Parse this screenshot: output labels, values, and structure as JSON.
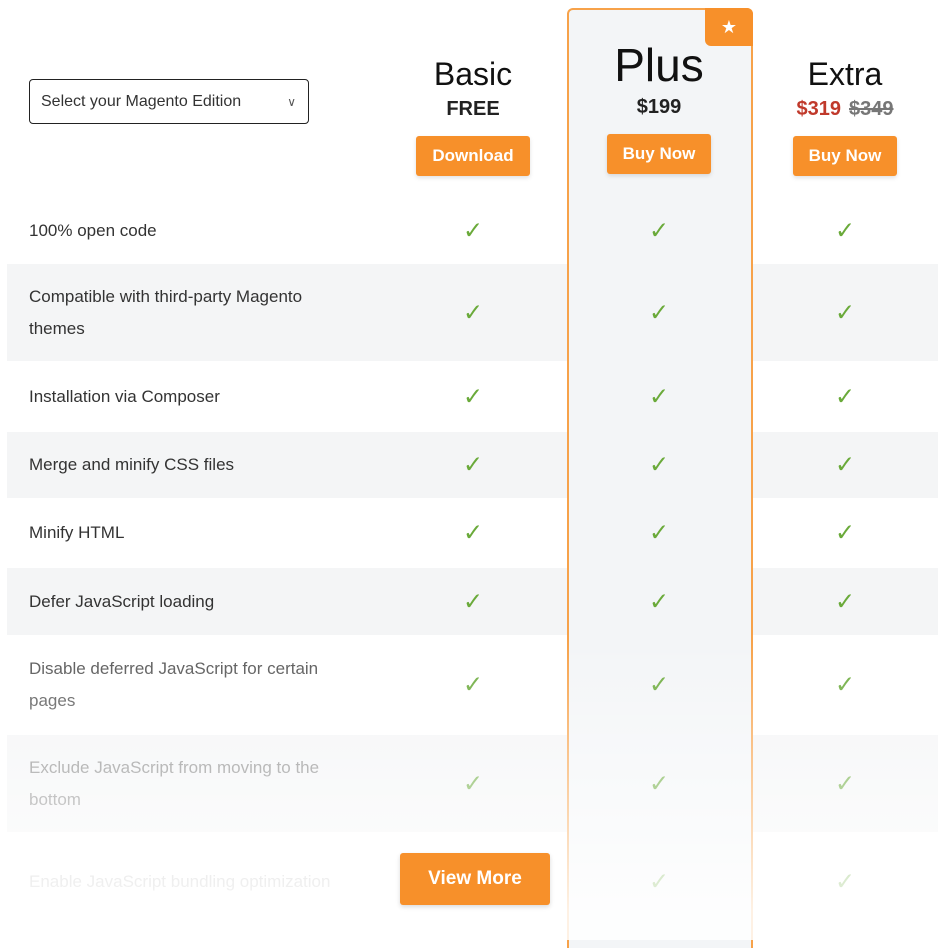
{
  "select": {
    "label": "Select your Magento Edition",
    "icon": "chevron-down-icon"
  },
  "plans": [
    {
      "name": "Basic",
      "price": "FREE",
      "button": "Download"
    },
    {
      "name": "Plus",
      "price": "$199",
      "button": "Buy Now",
      "badge_icon": "star-icon"
    },
    {
      "name": "Extra",
      "price": "$319",
      "old_price": "$349",
      "button": "Buy Now"
    }
  ],
  "features": [
    "100% open code",
    "Compatible with third-party Magento themes",
    "Installation via Composer",
    "Merge and minify CSS files",
    "Minify HTML",
    "Defer JavaScript loading",
    "Disable deferred JavaScript for certain pages",
    "Exclude JavaScript from moving to the bottom",
    "Enable JavaScript bundling optimization"
  ],
  "check_glyph": "✓",
  "view_more": "View More",
  "colors": {
    "accent": "#f7902a",
    "check": "#6aaa3a",
    "sale": "#c0392b"
  }
}
